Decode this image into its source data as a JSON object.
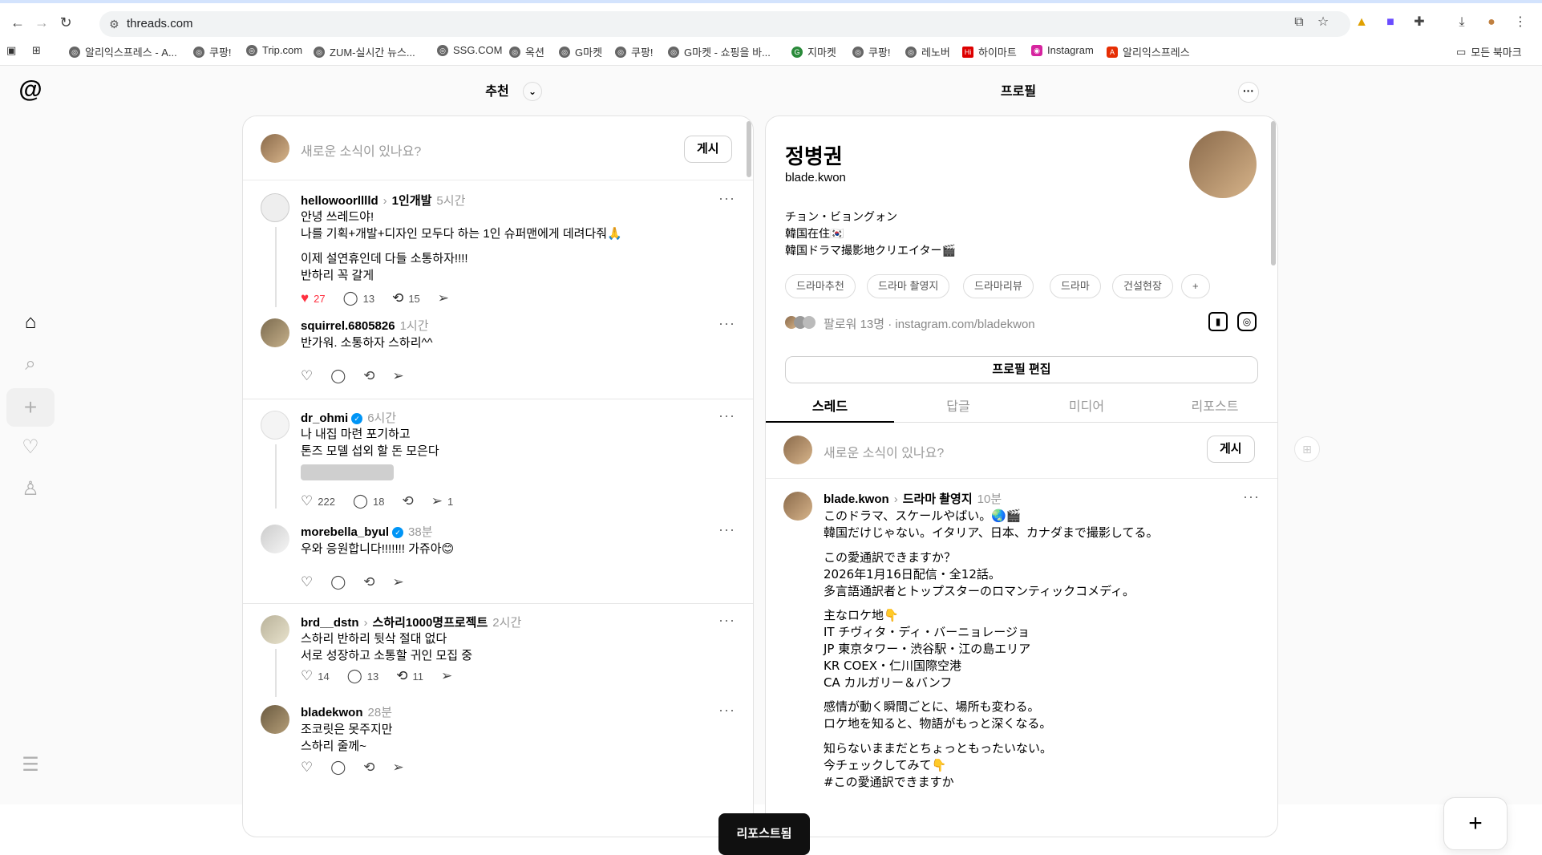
{
  "browser": {
    "url": "threads.com",
    "bookmarks": [
      "알리익스프레스 - A...",
      "쿠팡!",
      "Trip.com",
      "ZUM-실시간 뉴스...",
      "SSG.COM",
      "옥션",
      "G마켓",
      "쿠팡!",
      "G마켓 - 쇼핑을 바...",
      "지마켓",
      "쿠팡!",
      "레노버",
      "하이마트",
      "Instagram",
      "알리익스프레스"
    ],
    "all_bookmarks": "모든 북마크"
  },
  "feed": {
    "header": "추천",
    "composer_placeholder": "새로운 소식이 있나요?",
    "post_button": "게시",
    "posts": [
      {
        "user": "hellowoorlllld",
        "topic": "1인개발",
        "time": "5시간",
        "text": "안녕 쓰레드야!\n나를 기획+개발+디자인 모두다 하는 1인 슈퍼맨에게 데려다줘🙏",
        "text2": "이제 설연휴인데 다들 소통하자!!!!\n반하리 꼭 갈게",
        "likes": "27",
        "comments": "13",
        "reposts": "15"
      },
      {
        "user": "squirrel.6805826",
        "time": "1시간",
        "text": "반가워. 소통하자 스하리^^"
      },
      {
        "user": "dr_ohmi",
        "time": "6시간",
        "text": "나 내집 마련 포기하고\n톤즈 모델 섭외 할 돈 모은다",
        "likes": "222",
        "comments": "18",
        "shares": "1"
      },
      {
        "user": "morebella_byul",
        "time": "38분",
        "text": "우와 응원합니다!!!!!!! 가쥬아😊"
      },
      {
        "user": "brd__dstn",
        "topic": "스하리1000명프로젝트",
        "time": "2시간",
        "text": "스하리 반하리 뒷삭 절대 없다\n서로 성장하고 소통할 귀인 모집 중",
        "likes": "14",
        "comments": "13",
        "reposts": "11"
      },
      {
        "user": "bladekwon",
        "time": "28분",
        "text": "조코릿은 못주지만\n스하리 줄께~"
      }
    ]
  },
  "profile": {
    "header": "프로필",
    "name": "정병권",
    "handle": "blade.kwon",
    "bio": "チョン・ビョングォン\n韓国在住🇰🇷\n韓国ドラマ撮影地クリエイター🎬",
    "tags": [
      "드라마추천",
      "드라마 촬영지",
      "드라마리뷰",
      "드라마",
      "건설현장",
      "+"
    ],
    "followers": "팔로워 13명 · instagram.com/bladekwon",
    "edit_button": "프로필 편집",
    "tabs": [
      "스레드",
      "답글",
      "미디어",
      "리포스트"
    ],
    "composer_placeholder": "새로운 소식이 있나요?",
    "post_button": "게시",
    "post": {
      "user": "blade.kwon",
      "topic": "드라마 촬영지",
      "time": "10분",
      "p1": "このドラマ、スケールやばい。🌏🎬\n韓国だけじゃない。イタリア、日本、カナダまで撮影してる。",
      "p2": "この愛通訳できますか？\n2026年1月16日配信・全12話。\n多言語通訳者とトップスターのロマンティックコメディ。",
      "p3": "主なロケ地👇\nIT チヴィタ・ディ・バーニョレージョ\nJP 東京タワー・渋谷駅・江の島エリア\nKR COEX・仁川国際空港\nCA カルガリー＆バンフ",
      "p4": "感情が動く瞬間ごとに、場所も変わる。\nロケ地を知ると、物語がもっと深くなる。",
      "p5": "知らないままだとちょっともったいない。\n今チェックしてみて👇\n#この愛通訳できますか"
    }
  },
  "toast": "리포스트됨"
}
